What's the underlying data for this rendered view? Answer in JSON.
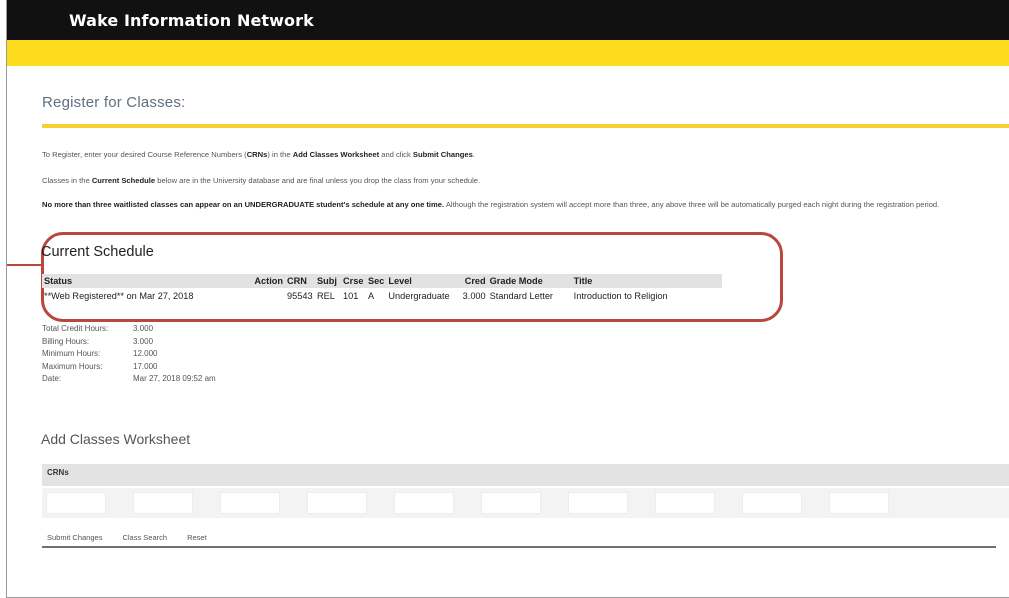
{
  "header": {
    "title": "Wake Information Network"
  },
  "page": {
    "heading": "Register for Classes:",
    "info": [
      {
        "prefix": "To Register, enter your desired Course Reference Numbers (",
        "bold1": "CRNs",
        "middle": ") in the ",
        "bold2": "Add Classes Worksheet",
        "middle2": " and click ",
        "bold3": "Submit Changes",
        "suffix": "."
      },
      {
        "prefix": "Classes in the ",
        "bold1": "Current Schedule",
        "suffix": " below are in the University database and are final unless you drop the class from your schedule."
      },
      {
        "bold1": "No more than three waitlisted classes can appear on an UNDERGRADUATE student's schedule at any one time.",
        "suffix": " Although the registration system will accept more than three, any above three will be automatically purged each night during the registration period."
      }
    ]
  },
  "current_schedule": {
    "title": "Current Schedule",
    "columns": {
      "status": "Status",
      "action": "Action",
      "crn": "CRN",
      "subj": "Subj",
      "crse": "Crse",
      "sec": "Sec",
      "level": "Level",
      "cred": "Cred",
      "grade_mode": "Grade Mode",
      "title": "Title"
    },
    "rows": [
      {
        "status": "**Web Registered** on Mar 27, 2018",
        "action": "",
        "crn": "95543",
        "subj": "REL",
        "crse": "101",
        "sec": "A",
        "level": "Undergraduate",
        "cred": "3.000",
        "grade_mode": "Standard Letter",
        "title": "Introduction to Religion"
      }
    ]
  },
  "summary": [
    {
      "label": "Total Credit Hours:",
      "value": "3.000"
    },
    {
      "label": "Billing Hours:",
      "value": "3.000"
    },
    {
      "label": "Minimum Hours:",
      "value": "12.000"
    },
    {
      "label": "Maximum Hours:",
      "value": "17.000"
    },
    {
      "label": "Date:",
      "value": "Mar 27, 2018 09:52 am"
    }
  ],
  "worksheet": {
    "title": "Add Classes Worksheet",
    "crns_label": "CRNs",
    "inputs": [
      "",
      "",
      "",
      "",
      "",
      "",
      "",
      "",
      "",
      ""
    ]
  },
  "buttons": {
    "submit": "Submit Changes",
    "search": "Class Search",
    "reset": "Reset"
  },
  "colors": {
    "header_bg": "#111111",
    "gold": "#fddc1f",
    "callout": "#b8473c"
  }
}
